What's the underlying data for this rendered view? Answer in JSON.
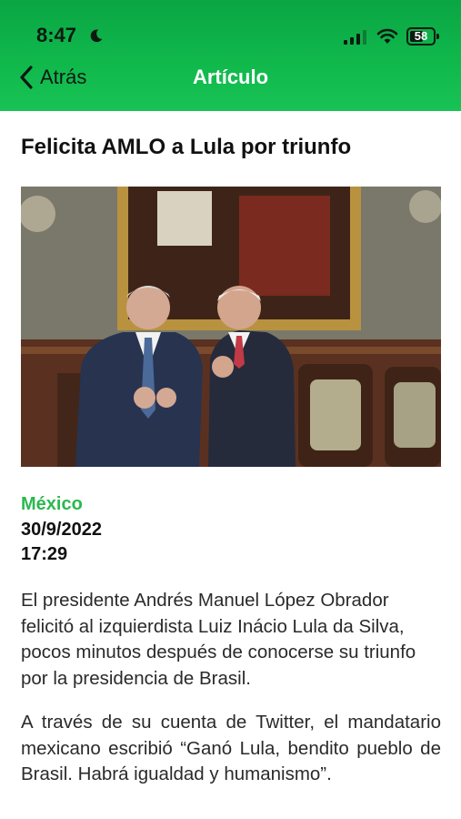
{
  "status_bar": {
    "time": "8:47",
    "battery": "58",
    "icons": [
      "moon-icon",
      "signal-icon",
      "wifi-icon",
      "battery-icon"
    ]
  },
  "nav": {
    "back_label": "Atrás",
    "title": "Artículo"
  },
  "article": {
    "title": "Felicita AMLO a Lula por triunfo",
    "section": "México",
    "date": "30/9/2022",
    "time": "17:29",
    "paragraphs": [
      "El presidente Andrés Manuel López Obrador felicitó al izquierdista Luiz Inácio Lula da Silva, pocos minutos después de conocerse su triunfo por la presidencia de Brasil.",
      "A través de su cuenta de Twitter, el mandatario mexicano escribió “Ganó Lula, bendito pueblo de Brasil. Habrá igualdad y humanismo”."
    ]
  },
  "colors": {
    "header_green": "#10b84c",
    "section_green": "#2bb84f"
  }
}
